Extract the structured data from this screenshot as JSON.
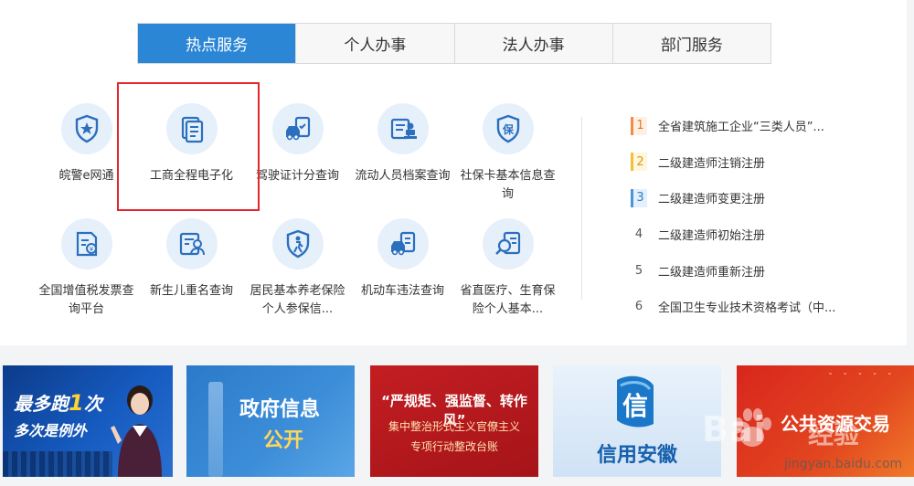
{
  "tabs": [
    {
      "label": "热点服务",
      "active": true
    },
    {
      "label": "个人办事",
      "active": false
    },
    {
      "label": "法人办事",
      "active": false
    },
    {
      "label": "部门服务",
      "active": false
    }
  ],
  "services": [
    {
      "label": "皖警e网通",
      "icon": "police-badge-icon"
    },
    {
      "label": "工商全程电子化",
      "icon": "documents-icon"
    },
    {
      "label": "驾驶证计分查询",
      "icon": "car-clipboard-icon"
    },
    {
      "label": "流动人员档案查询",
      "icon": "archive-stamp-icon"
    },
    {
      "label": "社保卡基本信息查询",
      "icon": "social-security-shield-icon"
    },
    {
      "label": "全国增值税发票查询平台",
      "icon": "invoice-icon"
    },
    {
      "label": "新生儿重名查询",
      "icon": "id-card-person-icon"
    },
    {
      "label": "居民基本养老保险个人参保信...",
      "icon": "elderly-shield-icon"
    },
    {
      "label": "机动车违法查询",
      "icon": "car-violation-icon"
    },
    {
      "label": "省直医疗、生育保险个人基本...",
      "icon": "search-document-icon"
    }
  ],
  "hot_list": [
    {
      "rank": "1",
      "text": "全省建筑施工企业“三类人员”..."
    },
    {
      "rank": "2",
      "text": "二级建造师注销注册"
    },
    {
      "rank": "3",
      "text": "二级建造师变更注册"
    },
    {
      "rank": "4",
      "text": "二级建造师初始注册"
    },
    {
      "rank": "5",
      "text": "二级建造师重新注册"
    },
    {
      "rank": "6",
      "text": "全国卫生专业技术资格考试（中..."
    }
  ],
  "banners": {
    "b1": {
      "line1_pre": "最多跑",
      "line1_highlight": "1",
      "line1_post": "次",
      "line2": "多次是例外"
    },
    "b2": {
      "line1": "政府信息",
      "line2": "公开"
    },
    "b3": {
      "line1": "“严规矩、强监督、转作风”",
      "line2": "集中整治形式主义官僚主义",
      "line3": "专项行动整改台账"
    },
    "b4": {
      "logo_char": "信",
      "line1": "信用安徽"
    },
    "b5": {
      "line1": "公共资源交易"
    }
  },
  "watermark": {
    "brand": "Bai",
    "brand2": "经验",
    "url": "jingyan.baidu.com"
  },
  "colors": {
    "accent": "#2b86d5",
    "icon_bg": "#e6f0fb",
    "highlight_border": "#e3262a"
  }
}
